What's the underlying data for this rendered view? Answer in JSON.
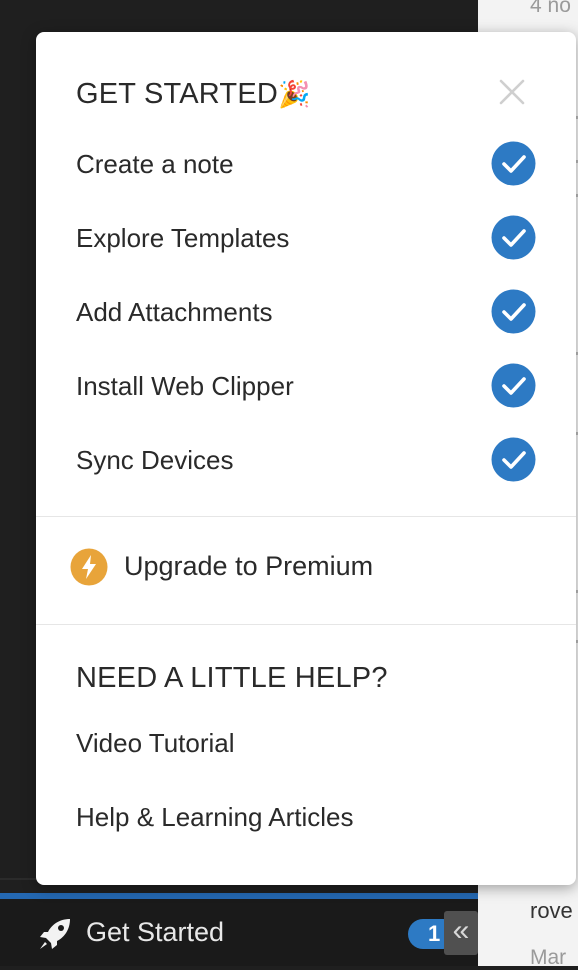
{
  "popup": {
    "title": "GET STARTED",
    "title_emoji": "🎉",
    "tasks": [
      {
        "label": "Create a note",
        "done": true
      },
      {
        "label": "Explore Templates",
        "done": true
      },
      {
        "label": "Add Attachments",
        "done": true
      },
      {
        "label": "Install Web Clipper",
        "done": true
      },
      {
        "label": "Sync Devices",
        "done": true
      }
    ],
    "upgrade_label": "Upgrade to Premium",
    "help_title": "NEED A LITTLE HELP?",
    "help_links": [
      "Video Tutorial",
      "Help & Learning Articles"
    ]
  },
  "bottom_bar": {
    "label": "Get Started",
    "badge_count": "1",
    "collapse_glyph": "«"
  },
  "note_list": {
    "top_meta": "4 no",
    "bottom_snippet": "rove",
    "bottom_meta": "Mar"
  },
  "colors": {
    "accent": "#2d7ac4",
    "upgrade": "#e8a43a",
    "sidebar_bg": "#1f1f1f"
  }
}
